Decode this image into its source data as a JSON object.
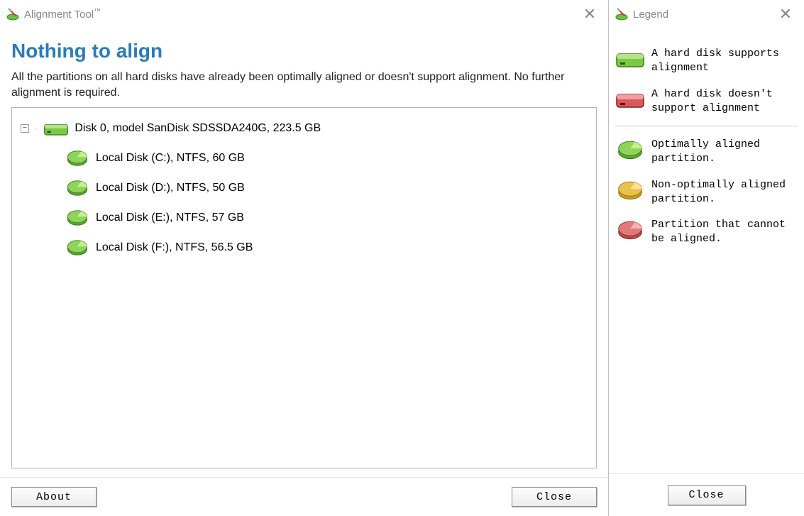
{
  "main": {
    "title": "Alignment Tool",
    "title_suffix": "™",
    "heading": "Nothing to align",
    "description": "All the partitions on all hard disks have already been optimally aligned or doesn't support alignment. No further alignment is required.",
    "disk": {
      "label": "Disk 0, model SanDisk SDSSDA240G, 223.5 GB",
      "partitions": [
        {
          "label": "Local Disk (C:), NTFS, 60 GB"
        },
        {
          "label": "Local Disk (D:), NTFS, 50 GB"
        },
        {
          "label": "Local Disk (E:), NTFS, 57 GB"
        },
        {
          "label": "Local Disk (F:), NTFS, 56.5 GB"
        }
      ]
    },
    "buttons": {
      "about": "About",
      "close": "Close"
    }
  },
  "legend": {
    "title": "Legend",
    "items_top": [
      {
        "text": "A hard disk supports alignment",
        "color": "green",
        "type": "disk"
      },
      {
        "text": "A hard disk doesn't support alignment",
        "color": "red",
        "type": "disk"
      }
    ],
    "items_bottom": [
      {
        "text": "Optimally aligned partition.",
        "color": "green",
        "type": "part"
      },
      {
        "text": "Non-optimally aligned partition.",
        "color": "gold",
        "type": "part"
      },
      {
        "text": "Partition that cannot be aligned.",
        "color": "red",
        "type": "part"
      }
    ],
    "close": "Close"
  }
}
